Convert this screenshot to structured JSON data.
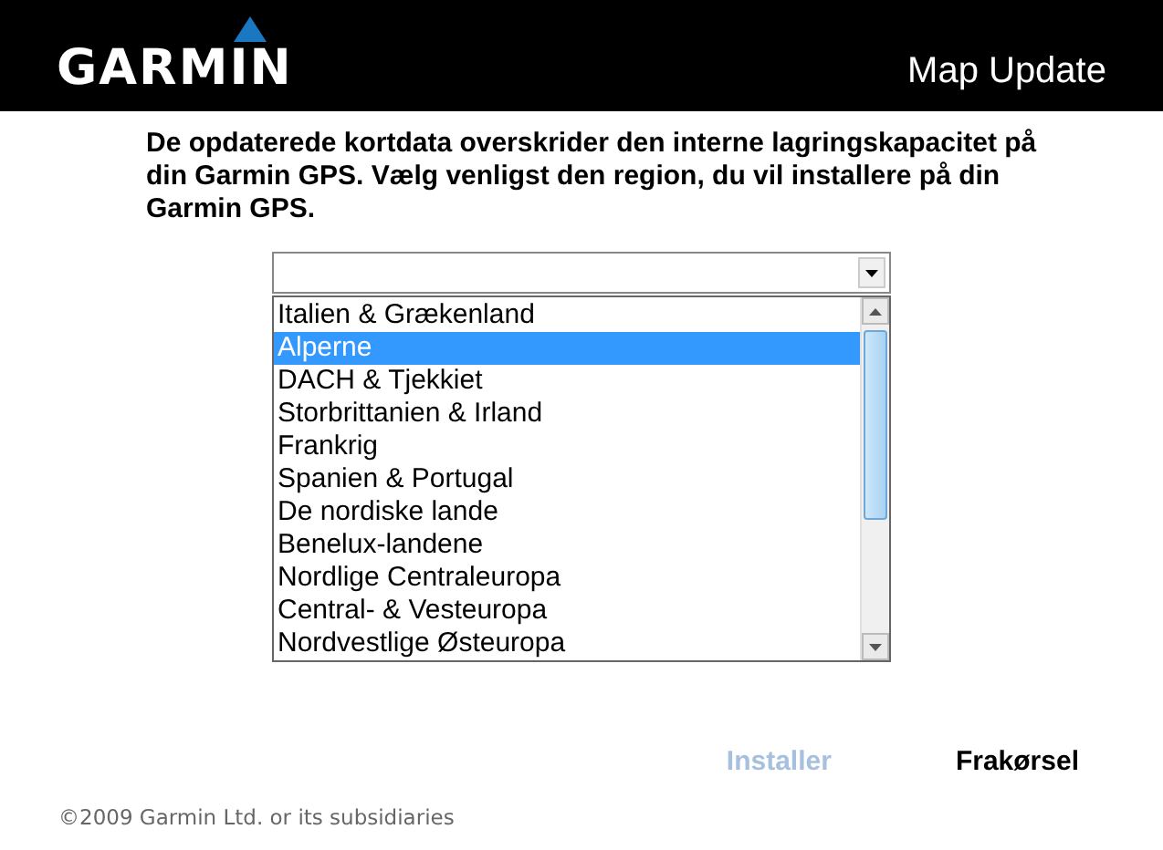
{
  "header": {
    "logo": "GARMIN",
    "title": "Map Update"
  },
  "message": "De opdaterede kortdata overskrider den interne lagringskapacitet på din Garmin GPS.  Vælg venligst den region, du vil installere på din Garmin GPS.",
  "region_list": {
    "items": [
      {
        "label": "Italien & Grækenland",
        "selected": false
      },
      {
        "label": "Alperne",
        "selected": true
      },
      {
        "label": "DACH & Tjekkiet",
        "selected": false
      },
      {
        "label": "Storbrittanien & Irland",
        "selected": false
      },
      {
        "label": "Frankrig",
        "selected": false
      },
      {
        "label": "Spanien & Portugal",
        "selected": false
      },
      {
        "label": "De nordiske lande",
        "selected": false
      },
      {
        "label": "Benelux-landene",
        "selected": false
      },
      {
        "label": "Nordlige Centraleuropa",
        "selected": false
      },
      {
        "label": "Central- & Vesteuropa",
        "selected": false
      },
      {
        "label": "Nordvestlige Østeuropa",
        "selected": false
      }
    ]
  },
  "buttons": [
    {
      "label": "Installer",
      "disabled": true
    },
    {
      "label": "Frakørsel",
      "disabled": false
    }
  ],
  "copyright": "©2009 Garmin Ltd. or its subsidiaries"
}
